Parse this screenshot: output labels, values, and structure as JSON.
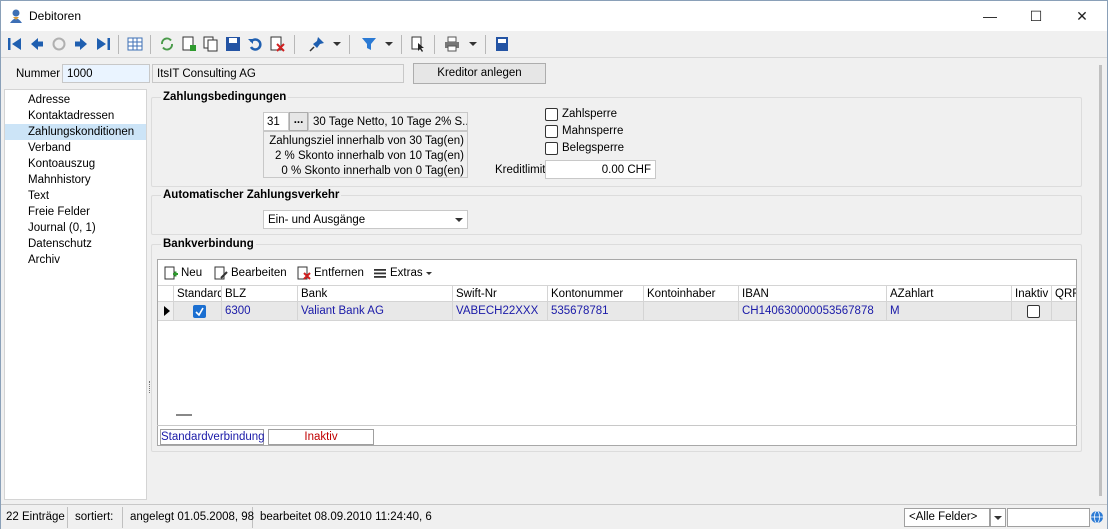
{
  "window": {
    "title": "Debitoren",
    "minimize": "—",
    "maximize": "☐",
    "close": "✕"
  },
  "header": {
    "nummer_label": "Nummer",
    "nummer_value": "1000",
    "name_value": "ItsIT Consulting AG",
    "kreditor_button": "Kreditor anlegen"
  },
  "nav": {
    "items": [
      "Adresse",
      "Kontaktadressen",
      "Zahlungskonditionen",
      "Verband",
      "Kontoauszug",
      "Mahnhistory",
      "Text",
      "Freie Felder",
      "Journal (0, 1)",
      "Datenschutz",
      "Archiv"
    ],
    "selected": "Zahlungskonditionen"
  },
  "zahlung": {
    "title": "Zahlungsbedingungen",
    "code": "31",
    "ellipsis": "...",
    "desc": "30 Tage Netto, 10 Tage 2% S...",
    "line1": "Zahlungsziel innerhalb von 30 Tag(en)",
    "line2": "2 % Skonto innerhalb von 10 Tag(en)",
    "line3": "0  % Skonto innerhalb von 0 Tag(en)",
    "zahlsperre": "Zahlsperre",
    "mahnsperre": "Mahnsperre",
    "belegsperre": "Belegsperre",
    "kreditlimit_label": "Kreditlimit",
    "kreditlimit_value": "0.00 CHF"
  },
  "auto": {
    "title": "Automatischer Zahlungsverkehr",
    "selected": "Ein- und Ausgänge"
  },
  "bank": {
    "title": "Bankverbindung",
    "toolbar": {
      "neu": "Neu",
      "bearbeiten": "Bearbeiten",
      "entfernen": "Entfernen",
      "extras": "Extras"
    },
    "columns": [
      "Standard",
      "BLZ",
      "Bank",
      "Swift-Nr",
      "Kontonummer",
      "Kontoinhaber",
      "IBAN",
      "AZahlart",
      "Inaktiv",
      "QRF"
    ],
    "row": {
      "blz": "6300",
      "bank": "Valiant Bank AG",
      "swift": "VABECH22XXX",
      "kontonummer": "535678781",
      "kontoinhaber": "",
      "iban": "CH1406300000535678​78",
      "azahlart": "M"
    },
    "legend_standard": "Standardverbindung",
    "legend_inaktiv": "Inaktiv"
  },
  "status": {
    "count": "22 Einträge",
    "sorted": "sortiert:",
    "created": "angelegt 01.05.2008, 98",
    "edited": "bearbeitet 08.09.2010 11:24:40,  6",
    "filter": "<Alle Felder>"
  },
  "colors": {
    "accent": "#1a1aa8",
    "selection": "#cce4f7",
    "inactive": "#c00000"
  }
}
